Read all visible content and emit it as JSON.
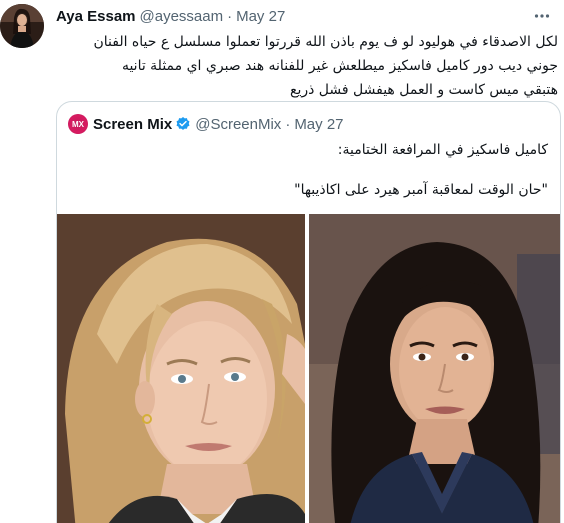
{
  "tweet": {
    "author_name": "Aya Essam",
    "author_handle": "@ayessaam",
    "separator": "·",
    "date": "May 27",
    "more_icon": "more-horizontal-icon",
    "text_lines": [
      "لكل الاصدقاء في هوليود لو ف يوم باذن الله قررتوا تعملوا مسلسل ع حياه الفنان",
      "جوني ديب دور كاميل فاسكيز ميطلعش غير للفنانه هند صبري اي ممثلة تانيه",
      "هتبقي ميس كاست و العمل هيفشل فشل ذريع"
    ]
  },
  "quoted_tweet": {
    "avatar_text": "MX",
    "author_name": "Screen Mix",
    "verified_icon": "verified-badge-icon",
    "author_handle": "@ScreenMix",
    "separator": "·",
    "date": "May 27",
    "text_line_1": "كاميل فاسكيز في المرافعة الختامية:",
    "text_line_2": "\"حان الوقت لمعاقبة آمبر هيرد على اكاذيبها\""
  },
  "colors": {
    "text_primary": "#0f1419",
    "text_secondary": "#536471",
    "border": "#cfd9de",
    "verified": "#1d9bf0",
    "quote_avatar": "#d81b60"
  }
}
